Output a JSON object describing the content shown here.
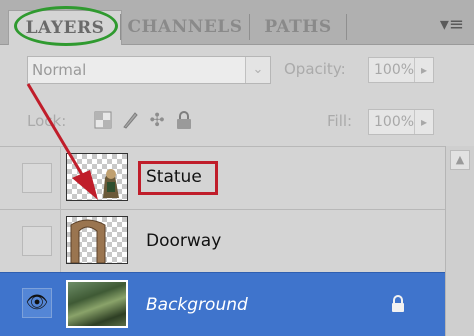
{
  "tabs": [
    {
      "label": "LAYERS",
      "active": true
    },
    {
      "label": "CHANNELS",
      "active": false
    },
    {
      "label": "PATHS",
      "active": false
    }
  ],
  "panel_menu_icon": "panel-menu-icon",
  "blend": {
    "mode": "Normal"
  },
  "opacity": {
    "label": "Opacity:",
    "value": "100%"
  },
  "lock": {
    "label": "Lock:",
    "icons": [
      "lock-transparent-icon",
      "lock-image-icon",
      "lock-position-icon",
      "lock-all-icon"
    ]
  },
  "fill": {
    "label": "Fill:",
    "value": "100%"
  },
  "layers": [
    {
      "name": "Statue",
      "visible": false,
      "selected": false
    },
    {
      "name": "Doorway",
      "visible": false,
      "selected": false
    },
    {
      "name": "Background",
      "visible": true,
      "selected": true,
      "locked": true
    }
  ],
  "annotations": {
    "highlight_color": "#c01d2a",
    "ring_color": "#2f9a2f"
  },
  "colors": {
    "selection": "#3f74cc",
    "panel": "#d4d4d4"
  }
}
